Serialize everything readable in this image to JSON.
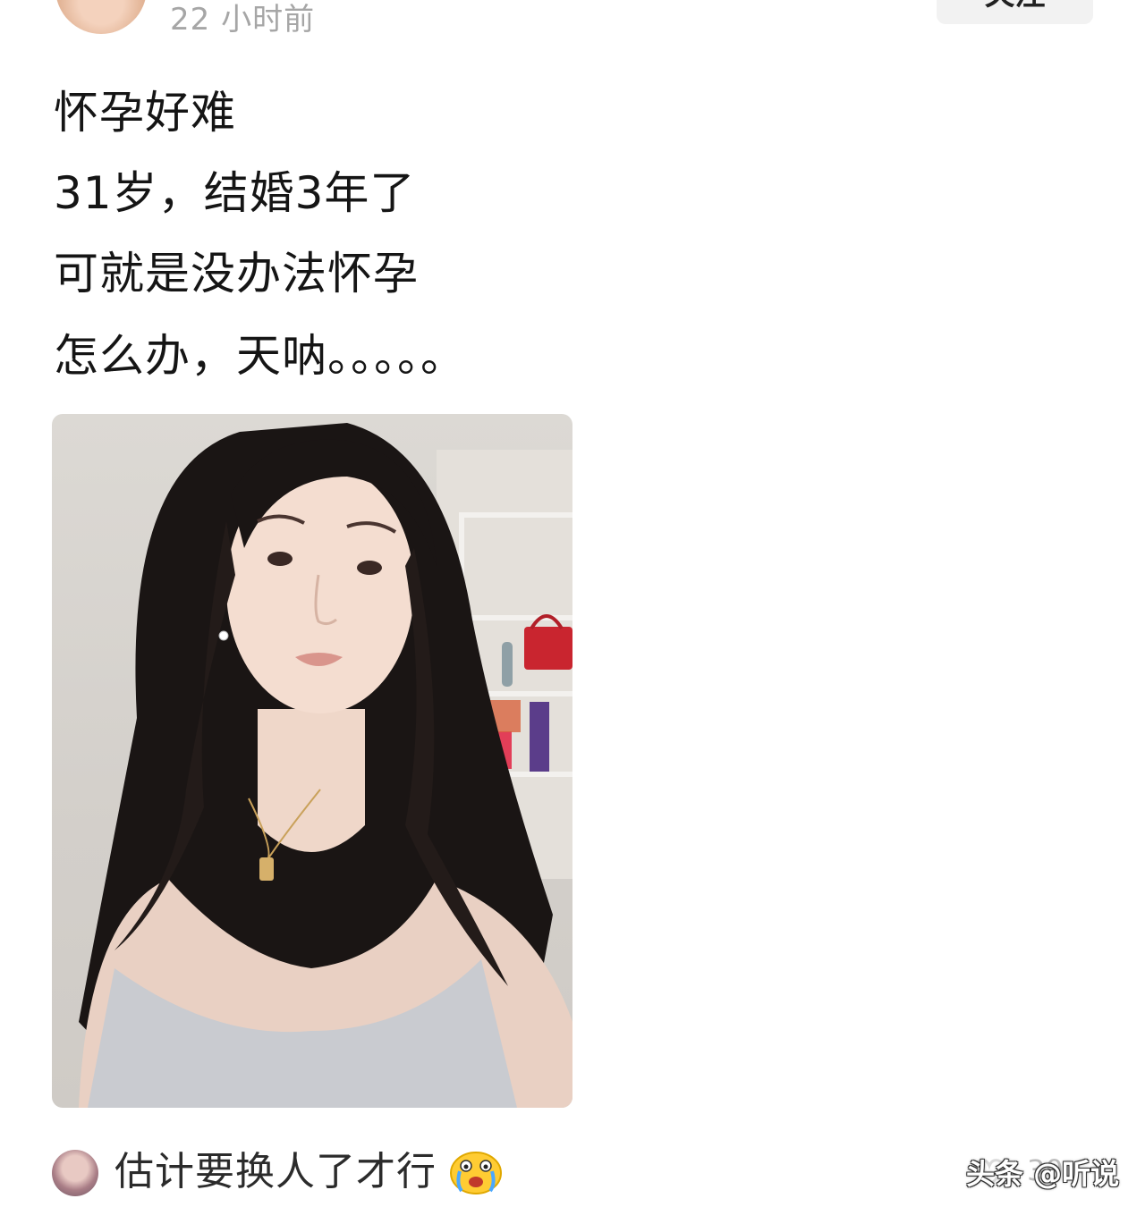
{
  "header": {
    "timestamp": "22 小时前",
    "follow_label": "关注"
  },
  "post": {
    "lines": [
      "怀孕好难",
      "31岁，结婚3年了",
      "可就是没办法怀孕",
      "怎么办，天呐。。。。。"
    ]
  },
  "comment": {
    "text": "估计要换人了才行",
    "emoji": "crying-face-emoji"
  },
  "footer": {
    "like_count": "30",
    "watermark": "头条 @听说"
  },
  "colors": {
    "timestamp": "#a6a6a6",
    "button_bg": "#f2f2f2",
    "text": "#151515"
  }
}
